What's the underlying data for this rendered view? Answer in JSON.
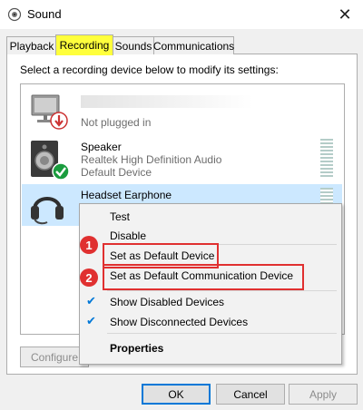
{
  "window": {
    "title": "Sound",
    "close_symbol": "✕"
  },
  "tabs": [
    {
      "label": "Playback"
    },
    {
      "label": "Recording"
    },
    {
      "label": "Sounds"
    },
    {
      "label": "Communications"
    }
  ],
  "instruction": "Select a recording device below to modify its settings:",
  "devices": [
    {
      "name": "",
      "lines": [
        "Not plugged in"
      ],
      "status_icon": "unplugged-arrow-icon"
    },
    {
      "name": "Speaker",
      "lines": [
        "Realtek High Definition Audio",
        "Default Device"
      ],
      "status_icon": "default-check-icon"
    },
    {
      "name": "Headset Earphone",
      "lines": [],
      "selected": true
    }
  ],
  "context_menu": {
    "items": [
      {
        "label": "Test"
      },
      {
        "label": "Disable"
      },
      {
        "label": "Set as Default Device",
        "annotation": "1"
      },
      {
        "label": "Set as Default Communication Device",
        "annotation": "2"
      },
      {
        "label": "Show Disabled Devices",
        "checked": true
      },
      {
        "label": "Show Disconnected Devices",
        "checked": true
      },
      {
        "label": "Properties",
        "bold": true
      }
    ]
  },
  "buttons": {
    "configure": "Configure",
    "ok": "OK",
    "cancel": "Cancel",
    "apply": "Apply"
  },
  "colors": {
    "highlight_tab": "#ffff3c",
    "selection": "#cce8ff",
    "annotation_red": "#e03030",
    "check_blue": "#0078d7",
    "status_green": "#1a9c3e"
  }
}
